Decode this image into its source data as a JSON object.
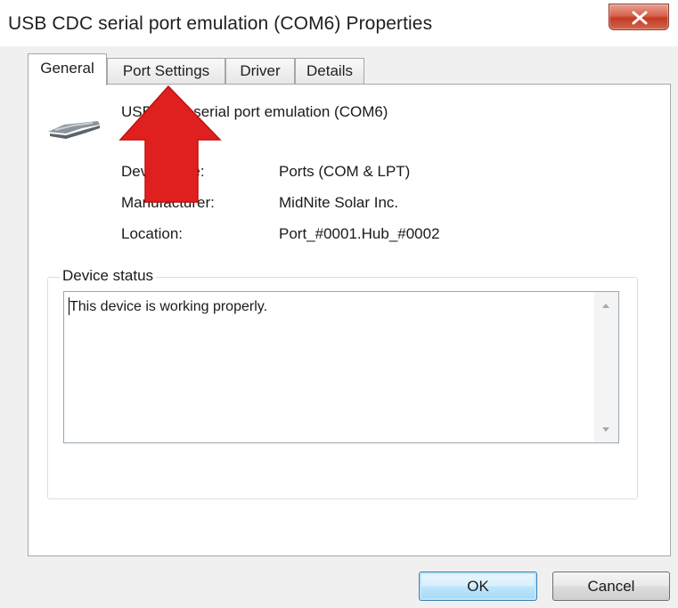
{
  "window": {
    "title": "USB CDC serial port emulation (COM6) Properties",
    "close_label": "X"
  },
  "tabs": [
    {
      "label": "General",
      "active": true
    },
    {
      "label": "Port Settings",
      "active": false
    },
    {
      "label": "Driver",
      "active": false
    },
    {
      "label": "Details",
      "active": false
    }
  ],
  "device": {
    "icon": "usb-cable-icon",
    "name": "USB CDC serial port emulation (COM6)",
    "properties": [
      {
        "label": "Device type:",
        "value": "Ports (COM & LPT)"
      },
      {
        "label": "Manufacturer:",
        "value": "MidNite Solar Inc."
      },
      {
        "label": "Location:",
        "value": "Port_#0001.Hub_#0002"
      }
    ]
  },
  "status": {
    "caption": "Device status",
    "text": "This device is working properly."
  },
  "buttons": {
    "ok": "OK",
    "cancel": "Cancel"
  },
  "annotation": {
    "icon": "red-up-arrow-icon",
    "color": "#e0201e",
    "points_to": "Port Settings"
  }
}
